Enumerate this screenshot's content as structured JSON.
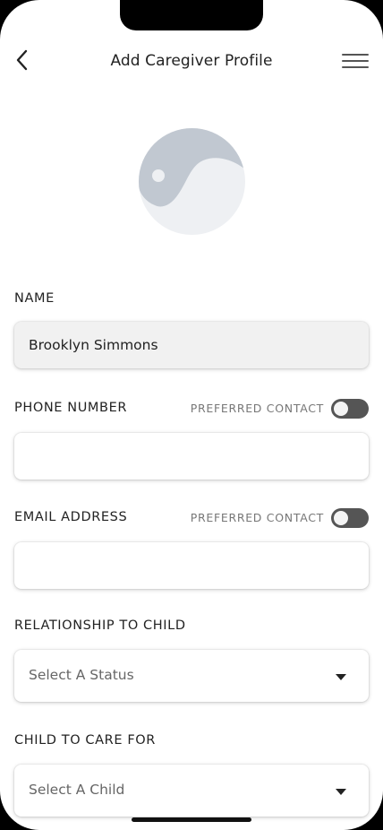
{
  "header": {
    "title": "Add Caregiver Profile"
  },
  "form": {
    "name": {
      "label": "NAME",
      "value": "Brooklyn Simmons"
    },
    "phone": {
      "label": "PHONE NUMBER",
      "preferred_label": "PREFERRED CONTACT",
      "value": "",
      "preferred_on": false
    },
    "email": {
      "label": "EMAIL ADDRESS",
      "preferred_label": "PREFERRED CONTACT",
      "value": "",
      "preferred_on": false
    },
    "relationship": {
      "label": "RELATIONSHIP TO CHILD",
      "placeholder": "Select A Status"
    },
    "child": {
      "label": "CHILD TO CARE FOR",
      "placeholder": "Select A Child"
    }
  },
  "icons": {
    "back": "chevron-left-icon",
    "menu": "hamburger-menu-icon",
    "avatar": "avatar-placeholder-icon",
    "dropdown": "caret-down-icon"
  },
  "colors": {
    "toggle_off": "#555555",
    "avatar_light": "#eef0f3",
    "avatar_dark": "#c1c8d1"
  }
}
